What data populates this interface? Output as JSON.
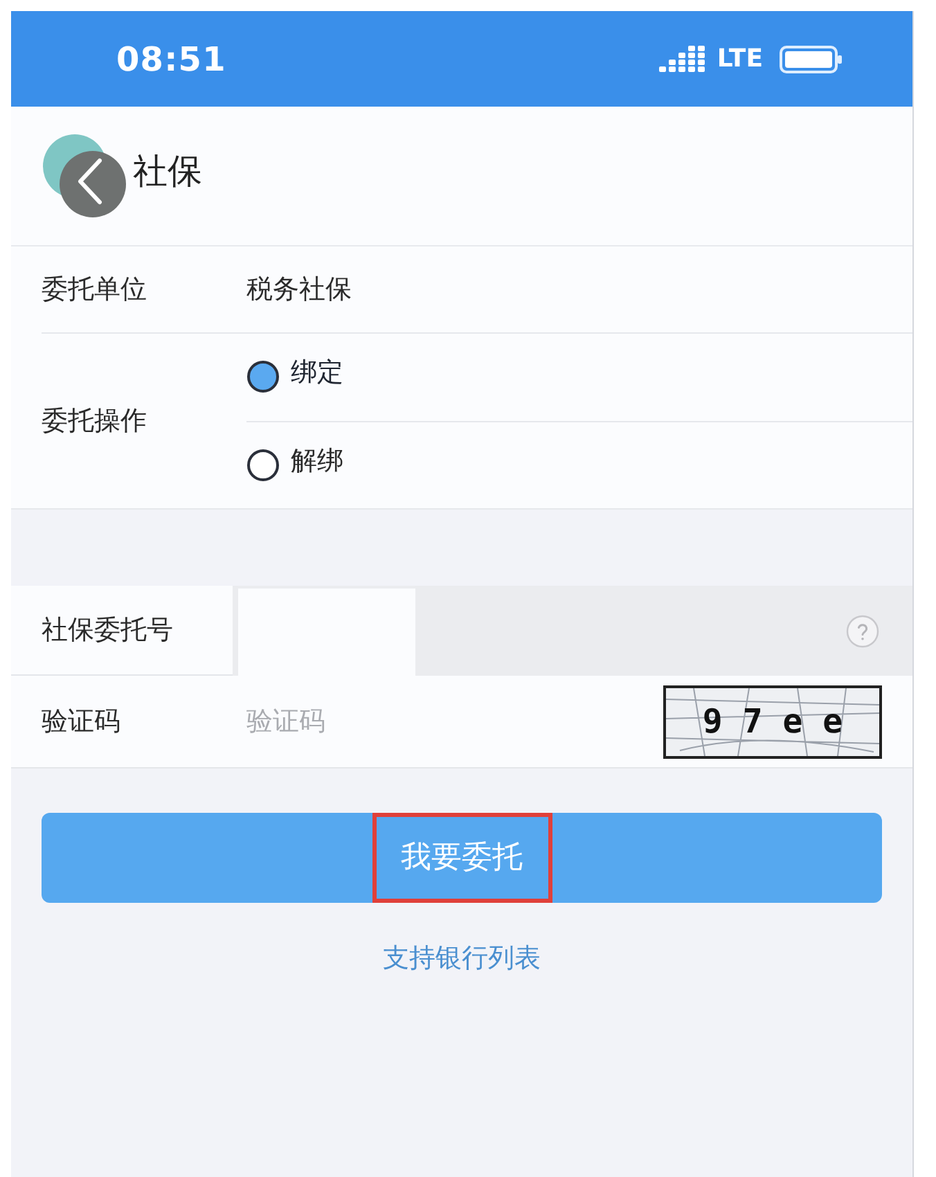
{
  "status_bar": {
    "time": "08:51",
    "network": "LTE"
  },
  "nav": {
    "title": "社保"
  },
  "form": {
    "unit": {
      "label": "委托单位",
      "value": "税务社保"
    },
    "operation": {
      "label": "委托操作",
      "options": [
        {
          "label": "绑定",
          "selected": true
        },
        {
          "label": "解绑",
          "selected": false
        }
      ]
    },
    "account": {
      "label": "社保委托号"
    },
    "captcha": {
      "label": "验证码",
      "placeholder": "验证码",
      "image_text": "9 7 e e"
    }
  },
  "submit": {
    "label": "我要委托",
    "highlighted": true
  },
  "link": "支持银行列表"
}
